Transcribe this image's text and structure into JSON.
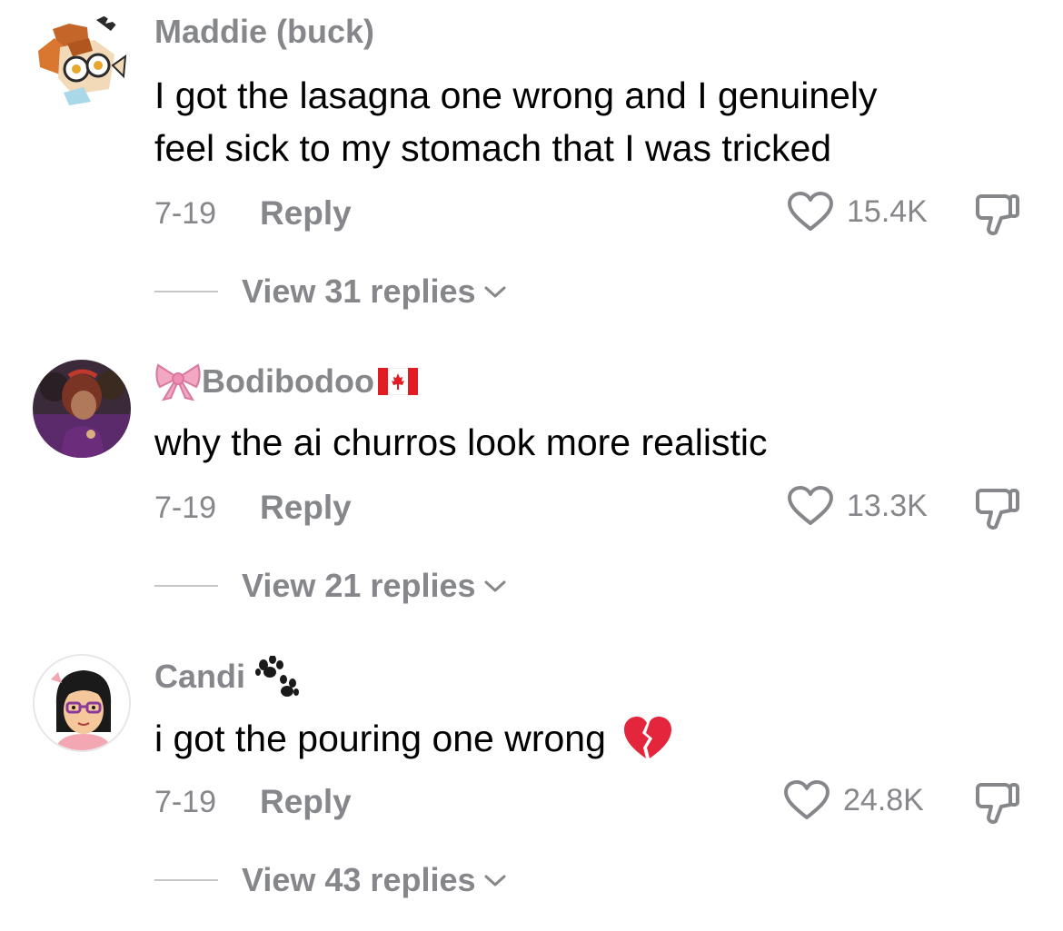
{
  "comments": [
    {
      "username": "Maddie (buck)",
      "text": "I got the lasagna one wrong and I genuinely\nfeel sick to my stomach that I was tricked",
      "date": "7-19",
      "reply_label": "Reply",
      "likes": "15.4K",
      "view_replies": "View 31 replies",
      "avatar_icon": "deer-character-avatar"
    },
    {
      "username": "Bodibodoo",
      "username_prefix_emoji": "ribbon-bow",
      "username_suffix_emoji": "canada-flag",
      "text": "why the ai churros look more realistic",
      "date": "7-19",
      "reply_label": "Reply",
      "likes": "13.3K",
      "view_replies": "View 21 replies",
      "avatar_icon": "cartoon-character-avatar"
    },
    {
      "username": "Candi",
      "username_suffix_emoji": "paw-prints",
      "text": "i got the pouring one wrong",
      "text_suffix_emoji": "broken-heart",
      "date": "7-19",
      "reply_label": "Reply",
      "likes": "24.8K",
      "view_replies": "View 43 replies",
      "avatar_icon": "mii-avatar"
    }
  ],
  "colors": {
    "text": "#000000",
    "secondary": "#86878b",
    "divider": "#c6c6c8"
  }
}
